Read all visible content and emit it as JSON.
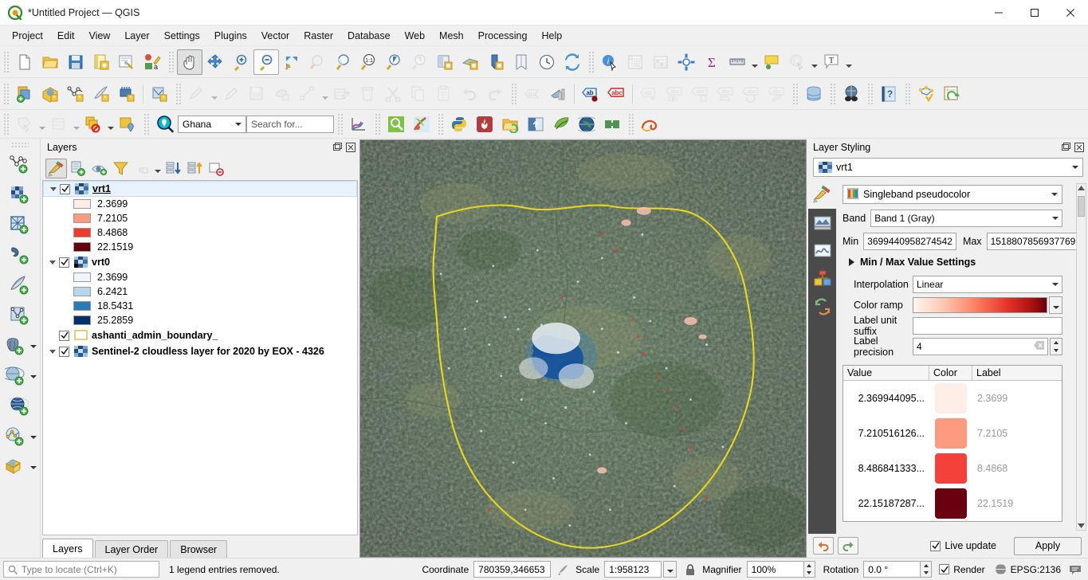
{
  "window": {
    "title": "*Untitled Project — QGIS",
    "app_icon": "qgis-logo-icon",
    "minimize": "–",
    "maximize": "❐",
    "close": "✕"
  },
  "menubar": [
    {
      "label": "Project"
    },
    {
      "label": "Edit"
    },
    {
      "label": "View"
    },
    {
      "label": "Layer"
    },
    {
      "label": "Settings"
    },
    {
      "label": "Plugins"
    },
    {
      "label": "Vector"
    },
    {
      "label": "Raster"
    },
    {
      "label": "Database"
    },
    {
      "label": "Web"
    },
    {
      "label": "Mesh"
    },
    {
      "label": "Processing"
    },
    {
      "label": "Help"
    }
  ],
  "toolbar1": [
    "new-project-icon",
    "open-project-icon",
    "save-project-icon",
    "save-project-as-icon",
    "new-print-layout-icon",
    "style-manager-icon",
    "pan-map-icon",
    "pan-to-selection-icon",
    "zoom-in-icon",
    "zoom-out-icon",
    "zoom-full-icon",
    "zoom-to-selection-icon",
    "zoom-to-layer-icon",
    "zoom-native-icon",
    "zoom-last-icon",
    "zoom-next-icon",
    "refresh-layer-icon",
    "new-map-view-icon",
    "new-3d-map-view-icon",
    "bookmarks-icon",
    "show-bookmarks-icon",
    "temporal-controller-icon",
    "refresh-icon",
    "identify-features-icon",
    "open-attribute-table-icon",
    "field-calculator-icon",
    "options-icon",
    "statistical-summary-icon",
    "measure-line-icon",
    "map-tips-icon",
    "run-feature-action-icon",
    "text-annotation-icon"
  ],
  "toolbar2": [
    "add-layer-icon",
    "open-data-source-manager-icon",
    "new-shapefile-icon",
    "new-spatialite-icon",
    "new-geopackage-icon",
    "new-memory-layer-icon",
    "current-edits-icon",
    "toggle-editing-icon",
    "save-layer-edits-icon",
    "add-feature-icon",
    "vertex-tool-icon",
    "modify-attributes-icon",
    "delete-selected-icon",
    "cut-features-icon",
    "copy-features-icon",
    "paste-features-icon",
    "undo-icon",
    "redo-icon",
    "select-features-icon",
    "deselect-icon",
    "label-icon",
    "label-highlight-icon",
    "pin-labels-icon",
    "show-hide-labels-icon",
    "move-label-icon",
    "rotate-label-icon",
    "change-label-icon",
    "db-manager-icon",
    "osm-download-icon",
    "help-contents-icon",
    "processing-toolbox-icon",
    "refresh-table-icon"
  ],
  "toolbar3": {
    "items_left": [
      "select-features-icon",
      "deselect-features-icon",
      "select-by-expression-icon",
      "zoom-to-selection-icon"
    ],
    "locator_icon": "geocoder-search-icon",
    "country_selector": {
      "value": "Ghana",
      "options": [
        "Ghana"
      ]
    },
    "search": {
      "placeholder": "Search for...",
      "value": ""
    },
    "items_right": [
      "plot-icon",
      "search-plugin-icon",
      "paint-effects-icon",
      "python-console-icon",
      "heatmap-icon",
      "open-folder-icon",
      "swipe-tool-icon",
      "leaf-plugin-icon",
      "globe-plugin-icon",
      "green-plugin-icon",
      "snail-plugin-icon"
    ]
  },
  "left_toolbar": [
    "add-vector-layer-icon",
    "add-raster-layer-icon",
    "add-mesh-layer-icon",
    "add-delimited-text-layer-icon",
    "add-spatialite-layer-icon",
    "add-virtual-layer-icon",
    "add-postgis-layer-icon",
    "add-wms-layer-icon",
    "add-wfs-layer-icon",
    "add-wcs-layer-icon",
    "add-arcgis-layer-icon"
  ],
  "layers_panel": {
    "title": "Layers",
    "undock_icon": "undock-icon",
    "close_icon": "close-icon",
    "toolbar": [
      {
        "name": "open-layer-styling-panel-icon",
        "active": true,
        "enabled": true
      },
      {
        "name": "add-group-icon",
        "active": false,
        "enabled": true
      },
      {
        "name": "manage-map-themes-icon",
        "active": false,
        "enabled": true
      },
      {
        "name": "filter-legend-icon",
        "active": false,
        "enabled": true
      },
      {
        "name": "filter-legend-by-expression-icon",
        "active": false,
        "enabled": false
      },
      {
        "name": "expand-all-icon",
        "active": false,
        "enabled": true
      },
      {
        "name": "collapse-all-icon",
        "active": false,
        "enabled": true
      },
      {
        "name": "remove-layer-icon",
        "active": false,
        "enabled": true
      }
    ],
    "tree": [
      {
        "type": "raster",
        "name": "vrt1",
        "checked": true,
        "selected": true,
        "expanded": true,
        "legend": [
          {
            "value": "2.3699",
            "color": "#fdeee8"
          },
          {
            "value": "7.2105",
            "color": "#fc9b7f"
          },
          {
            "value": "8.4868",
            "color": "#ef3b2c"
          },
          {
            "value": "22.1519",
            "color": "#67000d"
          }
        ]
      },
      {
        "type": "raster",
        "name": "vrt0",
        "checked": true,
        "selected": false,
        "expanded": true,
        "legend": [
          {
            "value": "2.3699",
            "color": "#eff5fb"
          },
          {
            "value": "6.2421",
            "color": "#b6d6ec"
          },
          {
            "value": "18.5431",
            "color": "#2a7ab9"
          },
          {
            "value": "25.2859",
            "color": "#08306b"
          }
        ]
      },
      {
        "type": "vector",
        "name": "ashanti_admin_boundary_",
        "checked": true,
        "selected": false,
        "expanded": false,
        "legend": []
      },
      {
        "type": "raster",
        "name": "Sentinel-2 cloudless layer for 2020 by EOX - 4326",
        "checked": true,
        "selected": false,
        "expanded": true,
        "legend": []
      }
    ],
    "tabs": [
      {
        "label": "Layers",
        "active": true
      },
      {
        "label": "Layer Order",
        "active": false
      },
      {
        "label": "Browser",
        "active": false
      }
    ]
  },
  "style_panel": {
    "title": "Layer Styling",
    "undock_icon": "undock-icon",
    "close_icon": "close-icon",
    "layer_selector": {
      "value": "vrt1",
      "icon": "raster-layer-icon"
    },
    "side_tabs": [
      "symbology-icon",
      "transparency-icon",
      "histogram-icon",
      "rendering-icon",
      "history-icon"
    ],
    "renderer": {
      "label": "Singleband pseudocolor",
      "icon": "color-ramp-icon"
    },
    "band": {
      "label": "Band",
      "value": "Band 1 (Gray)"
    },
    "min": {
      "label": "Min",
      "value": "3699440958274542"
    },
    "max": {
      "label": "Max",
      "value": "1518807856937769"
    },
    "minmax_settings": {
      "label": "Min / Max Value Settings",
      "expanded": false
    },
    "interpolation": {
      "label": "Interpolation",
      "value": "Linear"
    },
    "color_ramp": {
      "label": "Color ramp",
      "value": "Reds"
    },
    "label_unit_suffix": {
      "label": "Label unit suffix",
      "value": ""
    },
    "label_precision": {
      "label": "Label precision",
      "value": "4"
    },
    "table": {
      "headers": [
        "Value",
        "Color",
        "Label"
      ],
      "rows": [
        {
          "value": "2.369944095...",
          "color": "#fdeee8",
          "label": "2.3699"
        },
        {
          "value": "7.210516126...",
          "color": "#fc9b7f",
          "label": "7.2105"
        },
        {
          "value": "8.486841333...",
          "color": "#f4423a",
          "label": "8.4868"
        },
        {
          "value": "22.15187287...",
          "color": "#6a0111",
          "label": "22.1519"
        }
      ]
    },
    "footer": {
      "undo_icon": "undo-icon",
      "redo_icon": "redo-icon",
      "live_update": {
        "label": "Live update",
        "checked": true
      },
      "apply": "Apply"
    }
  },
  "statusbar": {
    "locate": {
      "placeholder": "Type to locate (Ctrl+K)",
      "icon": "search-icon"
    },
    "message": "1 legend entries removed.",
    "coordinate": {
      "label": "Coordinate",
      "value": "780359,346653"
    },
    "extent_icon": "toggle-extents-icon",
    "scale": {
      "label": "Scale",
      "value": "1:958123"
    },
    "lock_icon": "lock-scale-icon",
    "magnifier": {
      "label": "Magnifier",
      "value": "100%"
    },
    "rotation": {
      "label": "Rotation",
      "value": "0.0 °"
    },
    "render": {
      "label": "Render",
      "checked": true
    },
    "crs": {
      "label": "EPSG:2136",
      "icon": "crs-icon"
    },
    "messages_icon": "messages-icon"
  }
}
